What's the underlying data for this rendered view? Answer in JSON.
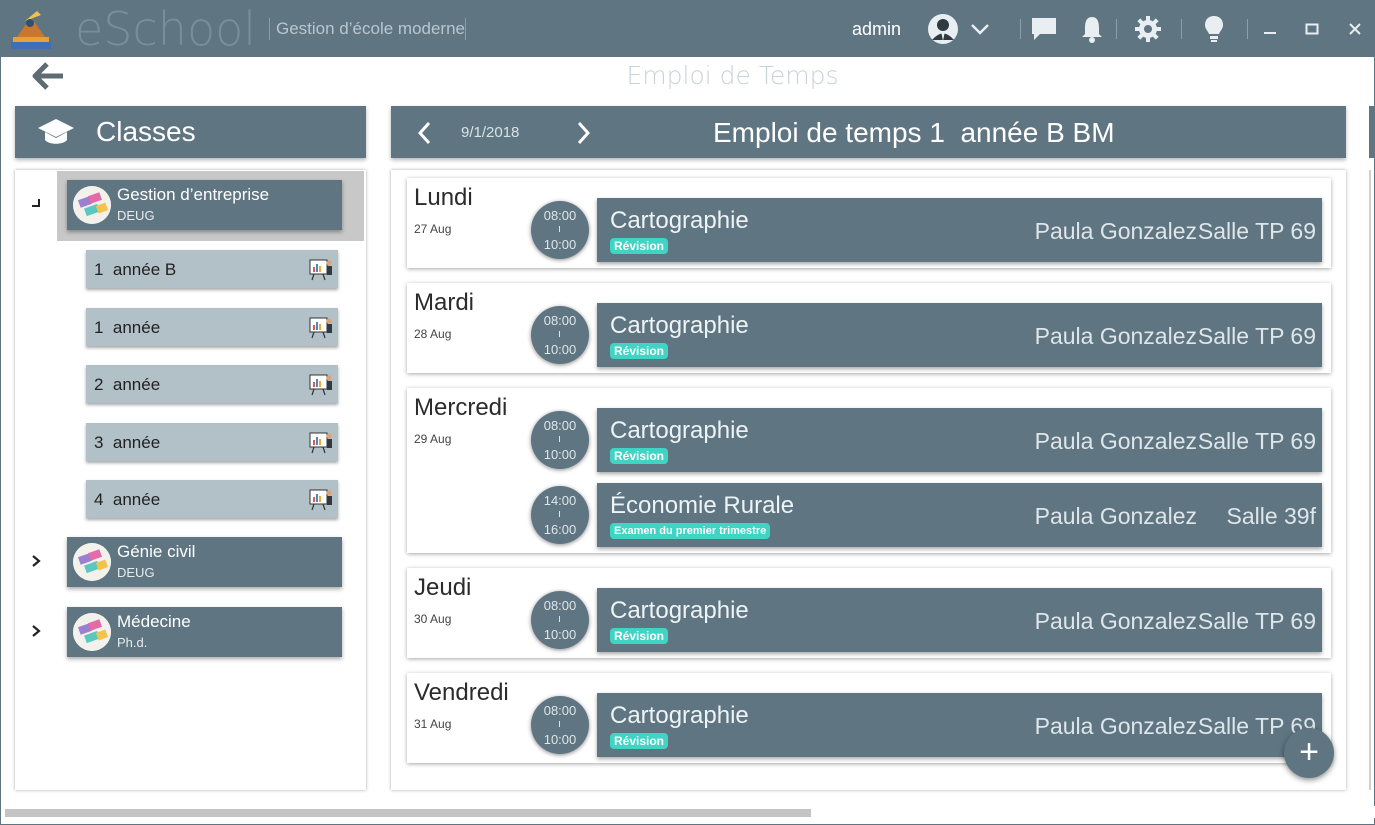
{
  "titlebar": {
    "app_name": "eSchool",
    "slogan": "Gestion d’école moderne",
    "user_name": "admin",
    "icons": [
      "user-avatar-icon",
      "chevron-down-icon",
      "chat-icon",
      "bell-icon",
      "gear-icon",
      "lightbulb-icon",
      "minimize-icon",
      "maximize-icon",
      "close-icon"
    ]
  },
  "page": {
    "title": "Emploi de Temps"
  },
  "classes": {
    "header": "Classes",
    "groups": [
      {
        "name": "Gestion d’entreprise",
        "degree": "DEUG",
        "expanded": true,
        "classes": [
          "1  année B",
          "1  année",
          "2  année",
          "3  année",
          "4  année"
        ]
      },
      {
        "name": "Génie civil",
        "degree": "DEUG",
        "expanded": false
      },
      {
        "name": "Médecine",
        "degree": "Ph.d.",
        "expanded": false
      }
    ]
  },
  "schedule": {
    "date": "9/1/2018",
    "title": "Emploi de temps 1  année B BM",
    "days": [
      {
        "name": "Lundi",
        "date": "27 Aug",
        "lessons": [
          {
            "start": "08:00",
            "end": "10:00",
            "subject": "Cartographie",
            "tag": "Révision",
            "teacher": "Paula Gonzalez",
            "room": "Salle TP 69"
          }
        ]
      },
      {
        "name": "Mardi",
        "date": "28 Aug",
        "lessons": [
          {
            "start": "08:00",
            "end": "10:00",
            "subject": "Cartographie",
            "tag": "Révision",
            "teacher": "Paula Gonzalez",
            "room": "Salle TP 69"
          }
        ]
      },
      {
        "name": "Mercredi",
        "date": "29 Aug",
        "lessons": [
          {
            "start": "08:00",
            "end": "10:00",
            "subject": "Cartographie",
            "tag": "Révision",
            "teacher": "Paula Gonzalez",
            "room": "Salle TP 69"
          },
          {
            "start": "14:00",
            "end": "16:00",
            "subject": "Économie Rurale",
            "tag": "Examen du premier trimestre",
            "teacher": "Paula Gonzalez",
            "room": "Salle 39f"
          }
        ]
      },
      {
        "name": "Jeudi",
        "date": "30 Aug",
        "lessons": [
          {
            "start": "08:00",
            "end": "10:00",
            "subject": "Cartographie",
            "tag": "Révision",
            "teacher": "Paula Gonzalez",
            "room": "Salle TP 69"
          }
        ]
      },
      {
        "name": "Vendredi",
        "date": "31 Aug",
        "lessons": [
          {
            "start": "08:00",
            "end": "10:00",
            "subject": "Cartographie",
            "tag": "Révision",
            "teacher": "Paula Gonzalez",
            "room": "Salle TP 69"
          }
        ]
      }
    ]
  },
  "fab": {
    "label": "+"
  },
  "colors": {
    "primary": "#5f7582",
    "class_item": "#b2c0c7",
    "tag": "#3fd4c4",
    "selection": "#c8c8c8"
  }
}
